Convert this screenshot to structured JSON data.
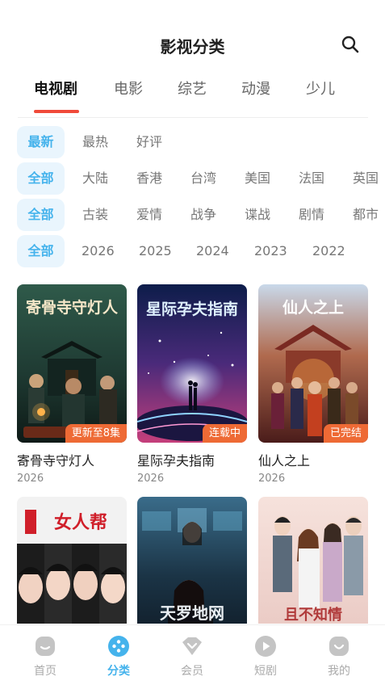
{
  "header": {
    "title": "影视分类",
    "search_icon": "search-icon"
  },
  "main_tabs": [
    {
      "label": "电视剧",
      "active": true
    },
    {
      "label": "电影",
      "active": false
    },
    {
      "label": "综艺",
      "active": false
    },
    {
      "label": "动漫",
      "active": false
    },
    {
      "label": "少儿",
      "active": false
    }
  ],
  "filters": {
    "sort": [
      "最新",
      "最热",
      "好评"
    ],
    "region": [
      "全部",
      "大陆",
      "香港",
      "台湾",
      "美国",
      "法国",
      "英国"
    ],
    "genre": [
      "全部",
      "古装",
      "爱情",
      "战争",
      "谍战",
      "剧情",
      "都市"
    ],
    "year": [
      "全部",
      "2026",
      "2025",
      "2024",
      "2023",
      "2022"
    ]
  },
  "videos": [
    {
      "title": "寄骨寺守灯人",
      "year": "2026",
      "badge": "更新至8集",
      "poster_text": "寄骨寺守灯人"
    },
    {
      "title": "星际孕夫指南",
      "year": "2026",
      "badge": "连载中",
      "poster_text": "星际孕夫指南"
    },
    {
      "title": "仙人之上",
      "year": "2026",
      "badge": "已完结",
      "poster_text": "仙人之上"
    },
    {
      "title": "",
      "year": "",
      "badge": "",
      "poster_text": "女人帮"
    },
    {
      "title": "",
      "year": "",
      "badge": "",
      "poster_text": "天罗地网"
    },
    {
      "title": "",
      "year": "",
      "badge": "",
      "poster_text": "且不知情"
    }
  ],
  "bottom_nav": [
    {
      "label": "首页",
      "icon": "home-icon",
      "active": false
    },
    {
      "label": "分类",
      "icon": "category-icon",
      "active": true
    },
    {
      "label": "会员",
      "icon": "vip-icon",
      "active": false
    },
    {
      "label": "短剧",
      "icon": "short-drama-icon",
      "active": false
    },
    {
      "label": "我的",
      "icon": "profile-icon",
      "active": false
    }
  ],
  "colors": {
    "accent": "#45b3ec",
    "tab_indicator": "#f04a3a",
    "badge": "#ee6a35",
    "chip_bg": "#e9f5fd"
  }
}
